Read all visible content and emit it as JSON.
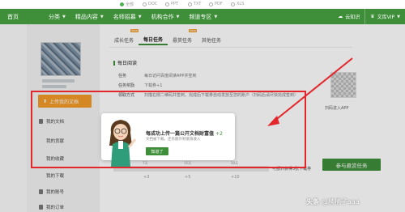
{
  "top_formats": [
    "全部",
    "DOC",
    "PPT",
    "TXT",
    "PDF",
    "XLS"
  ],
  "nav": {
    "home": "首页",
    "items": [
      "分类",
      "精品内容",
      "名师招募",
      "机构合作",
      "频道专区"
    ],
    "right": [
      "云知识",
      "文库VIP"
    ]
  },
  "sidebar": {
    "upload": "上传我的文档",
    "items": [
      "我的文档",
      "我的贡献",
      "我的收藏",
      "我的下载",
      "我的账号",
      "我的订单"
    ]
  },
  "tabs": {
    "items": [
      "成长任务",
      "每日任务",
      "悬赏任务",
      "其他任务"
    ],
    "badges": [
      "New",
      "",
      "New",
      ""
    ]
  },
  "section": {
    "title": "每日阅读"
  },
  "task_rows": [
    {
      "label": "任务",
      "text": "每日访问百度阅读APP并签到"
    },
    {
      "label": "任务奖励",
      "text": "下载券+1"
    },
    {
      "label": "领取方式",
      "text": "扫描右侧二维码并签到，完成后下载券自动发放至您的账户（扫码后请尽快完成签到）"
    }
  ],
  "qr_label": "扫码进入APP",
  "cta": "参与悬赏任务",
  "timeline": {
    "partial": "大于",
    "ticks": [
      "7天",
      "15天",
      "30天"
    ],
    "points": [
      "+3",
      "+5",
      "+10"
    ],
    "reward": "可额外获得3张下载券"
  },
  "tooltip": {
    "title": "每成功上传一篇公开文档财富值",
    "points": "+2",
    "desc": "文档被下载，还有额外财富值收入",
    "ok": "知道了"
  },
  "watermark": {
    "prefix": "头条",
    "handle": "@楠楠子aaa"
  },
  "colors": {
    "brand": "#3e8e3a",
    "accent": "#f39a2a",
    "highlight": "#e3262b"
  }
}
